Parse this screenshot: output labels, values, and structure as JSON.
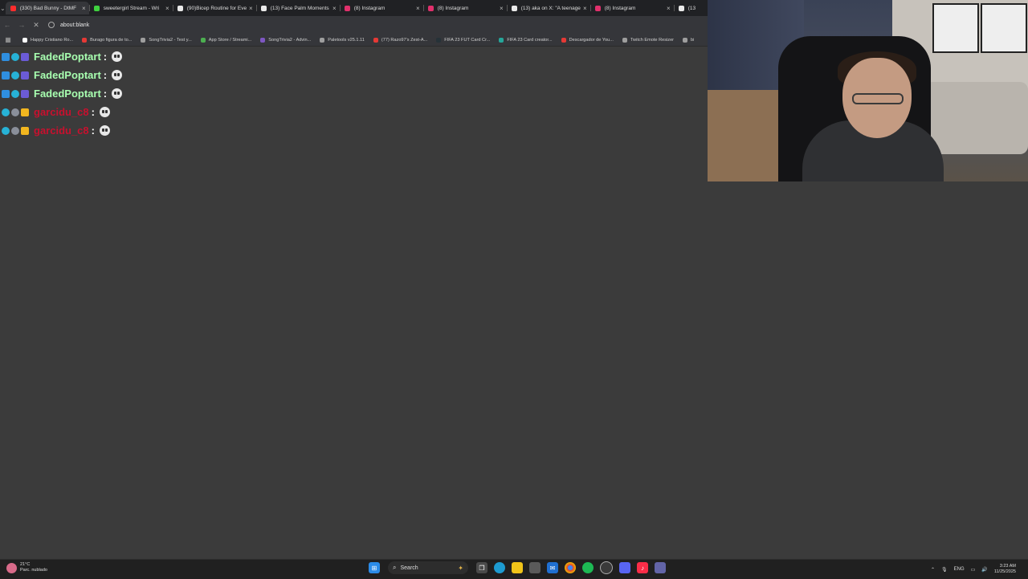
{
  "browser": {
    "tabs": [
      {
        "title": "(330) Bad Bunny - DtMF",
        "favicon_color": "#ff2d2d",
        "active": true
      },
      {
        "title": "sweetergirl Stream - Wri",
        "favicon_color": "#3fd13f",
        "active": false
      },
      {
        "title": "(90)Bicep Routine for Eve",
        "favicon_color": "#e9e9e9",
        "active": false
      },
      {
        "title": "(13) Face Palm Moments",
        "favicon_color": "#e9e9e9",
        "active": false
      },
      {
        "title": "(8) Instagram",
        "favicon_color": "#e1306c",
        "active": false
      },
      {
        "title": "(8) Instagram",
        "favicon_color": "#e1306c",
        "active": false
      },
      {
        "title": "(13) aka on X: \"A teenage",
        "favicon_color": "#e9e9e9",
        "active": false
      },
      {
        "title": "(8) Instagram",
        "favicon_color": "#e1306c",
        "active": false
      },
      {
        "title": "(13",
        "favicon_color": "#e9e9e9",
        "active": false
      }
    ],
    "address": "about:blank",
    "bookmarks": [
      {
        "label": "Happy Cristiano Ro...",
        "color": "#ffffff"
      },
      {
        "label": "Burago figura de to...",
        "color": "#e53935"
      },
      {
        "label": "SongTrivia2 - Test y...",
        "color": "#9e9e9e"
      },
      {
        "label": "App Store / Streami...",
        "color": "#4caf50"
      },
      {
        "label": "SongTrivia2 - Advin...",
        "color": "#7e57c2"
      },
      {
        "label": "Paletools v25.1.11",
        "color": "#9e9e9e"
      },
      {
        "label": "(77) Razo97's Zest-A...",
        "color": "#e53935"
      },
      {
        "label": "FIFA 23 FUT Card Cr...",
        "color": "#263238"
      },
      {
        "label": "FIFA 23 Card creator...",
        "color": "#26a69a"
      },
      {
        "label": "Descargador de You...",
        "color": "#e53935"
      },
      {
        "label": "Twitch Emote Resizer",
        "color": "#9e9e9e"
      },
      {
        "label": "bi",
        "color": "#9e9e9e"
      }
    ]
  },
  "chat": {
    "messages": [
      {
        "user": "FadedPoptart",
        "user_color": "#a8ffb0",
        "colon": ":",
        "emote": "ghost-emote",
        "badges": [
          "blue",
          "cyan",
          "purple"
        ]
      },
      {
        "user": "FadedPoptart",
        "user_color": "#a8ffb0",
        "colon": ":",
        "emote": "ghost-emote",
        "badges": [
          "blue",
          "cyan",
          "purple"
        ]
      },
      {
        "user": "FadedPoptart",
        "user_color": "#a8ffb0",
        "colon": ":",
        "emote": "ghost-emote",
        "badges": [
          "blue",
          "cyan",
          "purple"
        ]
      },
      {
        "user": "garcidu_c8",
        "user_color": "#c8102e",
        "colon": ":",
        "emote": "ghost-emote",
        "badges": [
          "cyan",
          "grey",
          "gold"
        ]
      },
      {
        "user": "garcidu_c8",
        "user_color": "#c8102e",
        "colon": ":",
        "emote": "ghost-emote",
        "badges": [
          "cyan",
          "grey",
          "gold"
        ]
      }
    ]
  },
  "taskbar": {
    "weather_temp": "21°C",
    "weather_desc": "Parc. nublado",
    "search_label": "Search",
    "language": "ENG",
    "time": "3:23 AM",
    "date": "11/25/2025"
  }
}
